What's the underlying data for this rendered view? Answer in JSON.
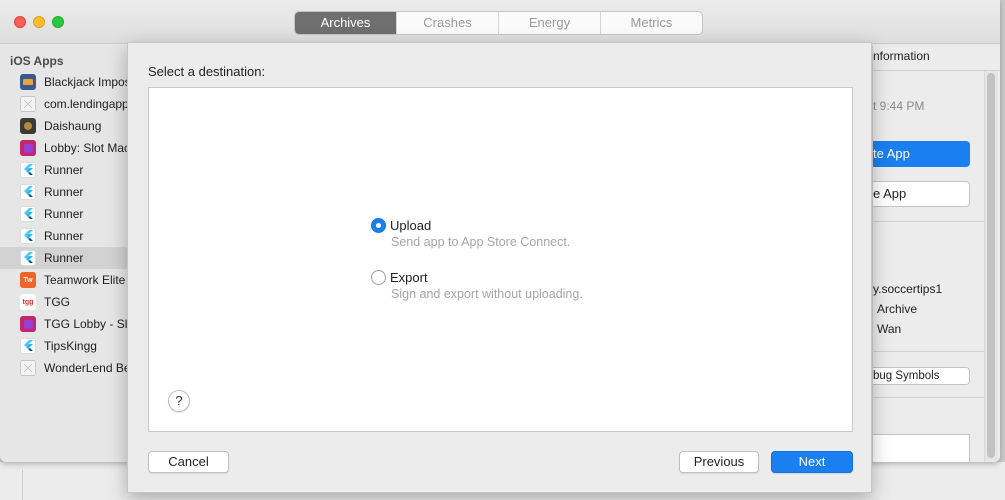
{
  "tabs": [
    {
      "label": "Archives",
      "active": true
    },
    {
      "label": "Crashes",
      "active": false
    },
    {
      "label": "Energy",
      "active": false
    },
    {
      "label": "Metrics",
      "active": false
    }
  ],
  "sidebar": {
    "header": "iOS Apps",
    "items": [
      {
        "label": "Blackjack Impos",
        "icon": "blackjack-app-icon",
        "color": "#3a5a8c"
      },
      {
        "label": "com.lendingapp",
        "icon": "placeholder-app-icon",
        "color": "#dddddd"
      },
      {
        "label": "Daishaung",
        "icon": "daishaung-app-icon",
        "color": "#3b3a33"
      },
      {
        "label": "Lobby: Slot Mac",
        "icon": "slot-app-icon",
        "color": "#c2266d"
      },
      {
        "label": "Runner",
        "icon": "flutter-icon",
        "color": "#ffffff"
      },
      {
        "label": "Runner",
        "icon": "flutter-icon",
        "color": "#ffffff"
      },
      {
        "label": "Runner",
        "icon": "flutter-icon",
        "color": "#ffffff"
      },
      {
        "label": "Runner",
        "icon": "flutter-icon",
        "color": "#ffffff"
      },
      {
        "label": "Runner",
        "icon": "flutter-icon",
        "color": "#ffffff",
        "selected": true
      },
      {
        "label": "Teamwork Elite",
        "icon": "teamwork-app-icon",
        "color": "#f0642a"
      },
      {
        "label": "TGG",
        "icon": "tgg-app-icon",
        "color": "#ffffff"
      },
      {
        "label": "TGG Lobby - Slo",
        "icon": "slot-app-icon",
        "color": "#c2266d"
      },
      {
        "label": "TipsKingg",
        "icon": "flutter-icon",
        "color": "#ffffff"
      },
      {
        "label": "WonderLend Be",
        "icon": "placeholder-app-icon",
        "color": "#dddddd"
      }
    ]
  },
  "info_panel": {
    "header": "nformation",
    "time": "t 9:44 PM",
    "distribute_button": "te App",
    "validate_button": "e App",
    "bundle_id": "y.soccertips1",
    "type": "Archive",
    "team": "Wan",
    "debug_symbols_button": "bug Symbols"
  },
  "sheet": {
    "title": "Select a destination:",
    "options": [
      {
        "label": "Upload",
        "description": "Send app to App Store Connect.",
        "selected": true
      },
      {
        "label": "Export",
        "description": "Sign and export without uploading.",
        "selected": false
      }
    ],
    "help": "?",
    "cancel": "Cancel",
    "previous": "Previous",
    "next": "Next"
  },
  "colors": {
    "accent": "#1a7ff1",
    "active_tab": "#6f6f6f"
  }
}
